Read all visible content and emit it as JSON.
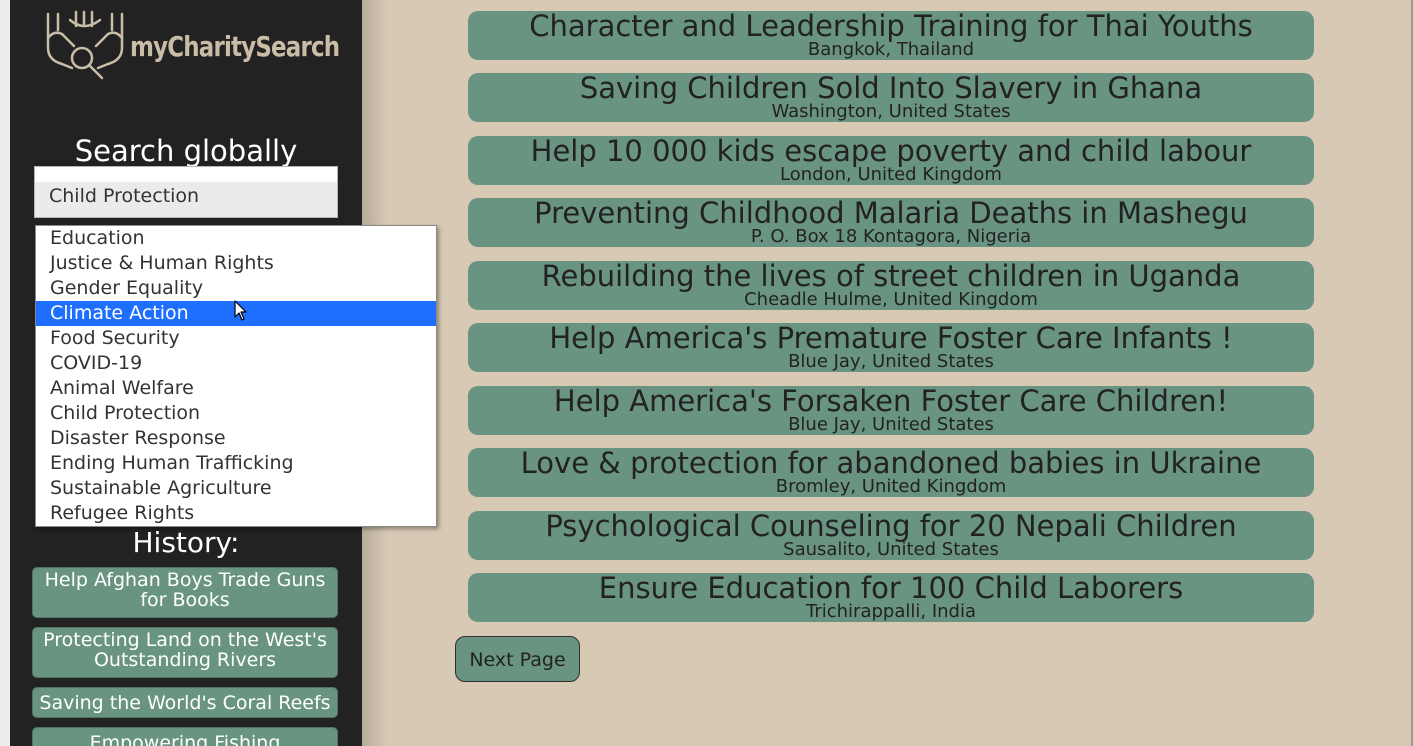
{
  "app": {
    "logo_text": "myCharitySearch"
  },
  "search": {
    "title": "Search globally",
    "selected_value": "Child Protection",
    "dropdown_options": [
      "Education",
      "Justice & Human Rights",
      "Gender Equality",
      "Climate Action",
      "Food Security",
      "COVID-19",
      "Animal Welfare",
      "Child Protection",
      "Disaster Response",
      "Ending Human Trafficking",
      "Sustainable Agriculture",
      "Refugee Rights"
    ],
    "highlighted_option": "Climate Action"
  },
  "history": {
    "title": "History:",
    "items": [
      "Help Afghan Boys Trade Guns for Books",
      "Protecting Land on the West's Outstanding Rivers",
      "Saving the World's Coral Reefs",
      "Empowering Fishing"
    ]
  },
  "results": [
    {
      "title": "Character and Leadership Training for Thai Youths",
      "location": "Bangkok, Thailand"
    },
    {
      "title": "Saving Children Sold Into Slavery in Ghana",
      "location": "Washington, United States"
    },
    {
      "title": "Help 10 000 kids escape poverty and child labour",
      "location": "London, United Kingdom"
    },
    {
      "title": "Preventing Childhood Malaria Deaths in Mashegu",
      "location": "P. O. Box 18 Kontagora, Nigeria"
    },
    {
      "title": "Rebuilding the lives of street children in Uganda",
      "location": "Cheadle Hulme, United Kingdom"
    },
    {
      "title": "Help America's Premature Foster Care Infants !",
      "location": "Blue Jay, United States"
    },
    {
      "title": "Help America's Forsaken Foster Care Children!",
      "location": "Blue Jay, United States"
    },
    {
      "title": "Love & protection for abandoned babies in Ukraine",
      "location": "Bromley, United Kingdom"
    },
    {
      "title": "Psychological Counseling for 20 Nepali Children",
      "location": "Sausalito, United States"
    },
    {
      "title": "Ensure Education for 100 Child Laborers",
      "location": "Trichirappalli, India"
    }
  ],
  "pagination": {
    "next_label": "Next Page"
  },
  "colors": {
    "background": "#d8c9b4",
    "sidebar": "#222222",
    "card": "#6a9482",
    "highlight": "#1e6fff"
  }
}
